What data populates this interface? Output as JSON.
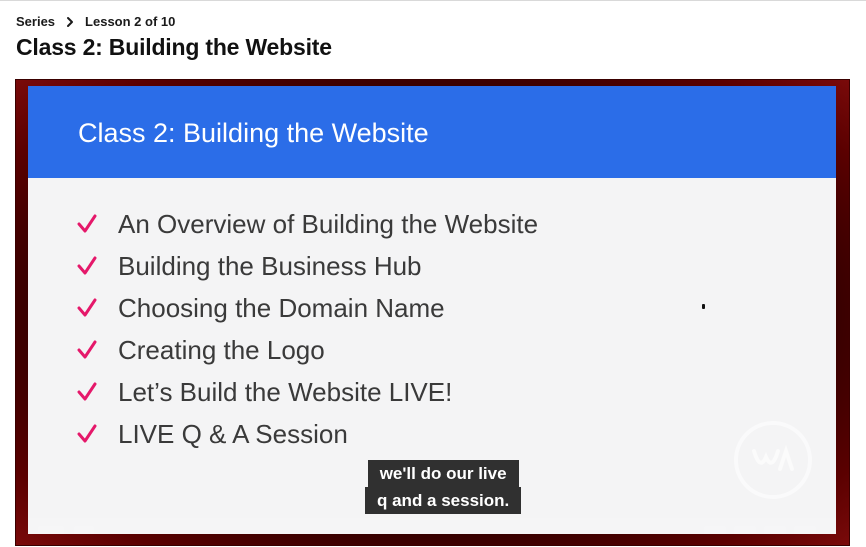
{
  "breadcrumb": {
    "series_label": "Series",
    "lesson_label": "Lesson 2 of 10"
  },
  "page": {
    "title": "Class 2: Building the Website"
  },
  "video": {
    "slide_title": "Class 2: Building the Website",
    "items": [
      "An Overview of Building the Website",
      "Building the Business Hub",
      "Choosing the Domain Name",
      "Creating the Logo",
      "Let’s Build the Website LIVE!",
      "LIVE Q & A Session"
    ],
    "captions": [
      "we'll do our live",
      "q and a session."
    ],
    "header_color": "#2b6de8",
    "check_color": "#e5186a"
  },
  "icons": {
    "breadcrumb_separator": "chevron-right-icon",
    "list_marker": "checkmark-icon",
    "watermark": "logo-watermark"
  }
}
